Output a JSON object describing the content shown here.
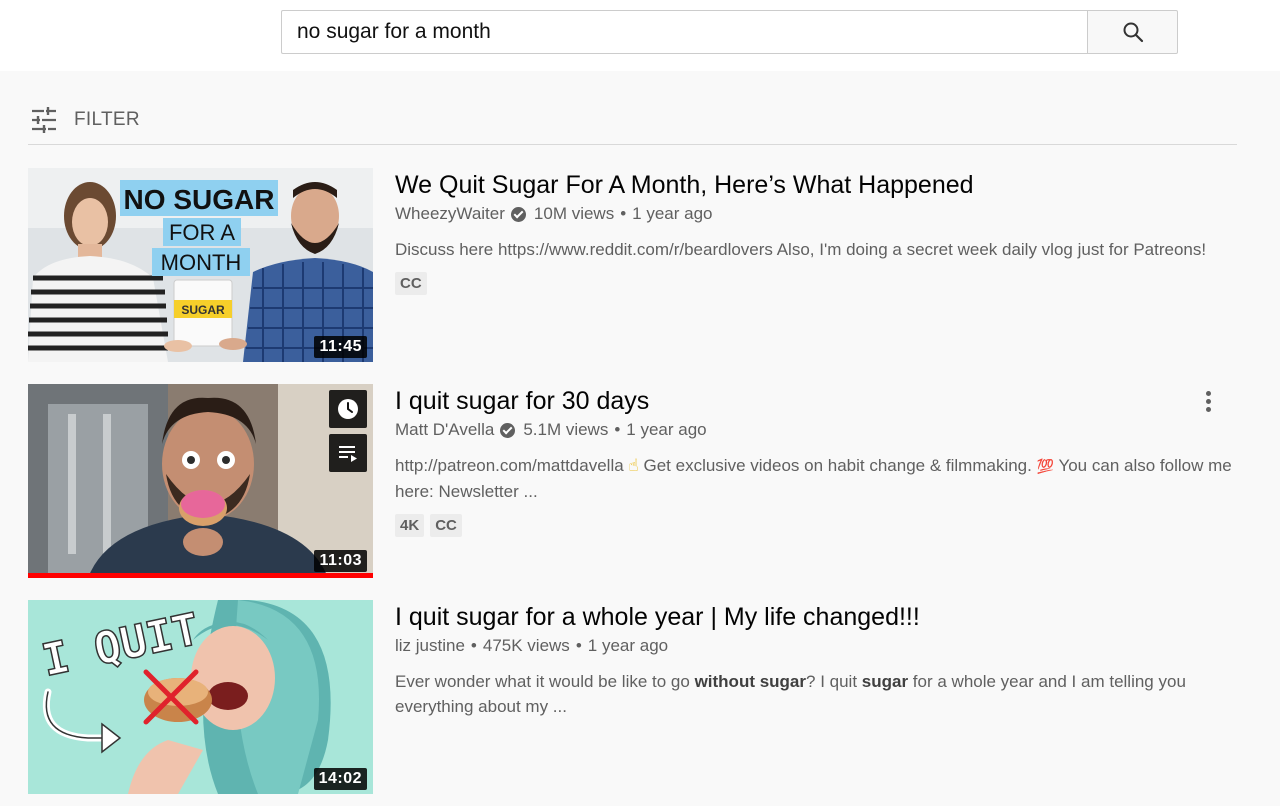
{
  "search": {
    "query": "no sugar for a month",
    "button_icon": "search-icon"
  },
  "filter": {
    "label": "FILTER",
    "icon": "filter-sliders-icon"
  },
  "results": [
    {
      "title": "We Quit Sugar For A Month, Here’s What Happened",
      "channel": "WheezyWaiter",
      "verified": true,
      "views": "10M views",
      "age": "1 year ago",
      "description": "Discuss here https://www.reddit.com/r/beardlovers Also, I'm doing a secret week daily vlog just for Patreons!",
      "badges": [
        "CC"
      ],
      "duration": "11:45",
      "thumb_text": [
        "NO SUGAR",
        "FOR A",
        "MONTH"
      ],
      "package_text": "SUGAR"
    },
    {
      "title": "I quit sugar for 30 days",
      "channel": "Matt D'Avella",
      "verified": true,
      "views": "5.1M views",
      "age": "1 year ago",
      "description_a": "http://patreon.com/mattdavella ",
      "description_b": " Get exclusive videos on habit change & filmmaking. ",
      "description_c": "  You can also follow me here: Newsletter ...",
      "emoji_1": "☝",
      "emoji_2": "💯",
      "badges": [
        "4K",
        "CC"
      ],
      "duration": "11:03",
      "watched_fraction": 1.0
    },
    {
      "title": "I quit sugar for a whole year | My life changed!!!",
      "channel": "liz justine",
      "verified": false,
      "views": "475K views",
      "age": "1 year ago",
      "description_a": "Ever wonder what it would be like to go ",
      "description_bold_1": "without sugar",
      "description_b": "? I quit ",
      "description_bold_2": "sugar",
      "description_c": " for a whole year and I am telling you everything about my ...",
      "duration": "14:02",
      "thumb_text": "I QUIT"
    }
  ],
  "colors": {
    "page_bg": "#f9f9f9",
    "progress_red": "#ff0000",
    "thumb3_bg": "#a8e6d9"
  }
}
